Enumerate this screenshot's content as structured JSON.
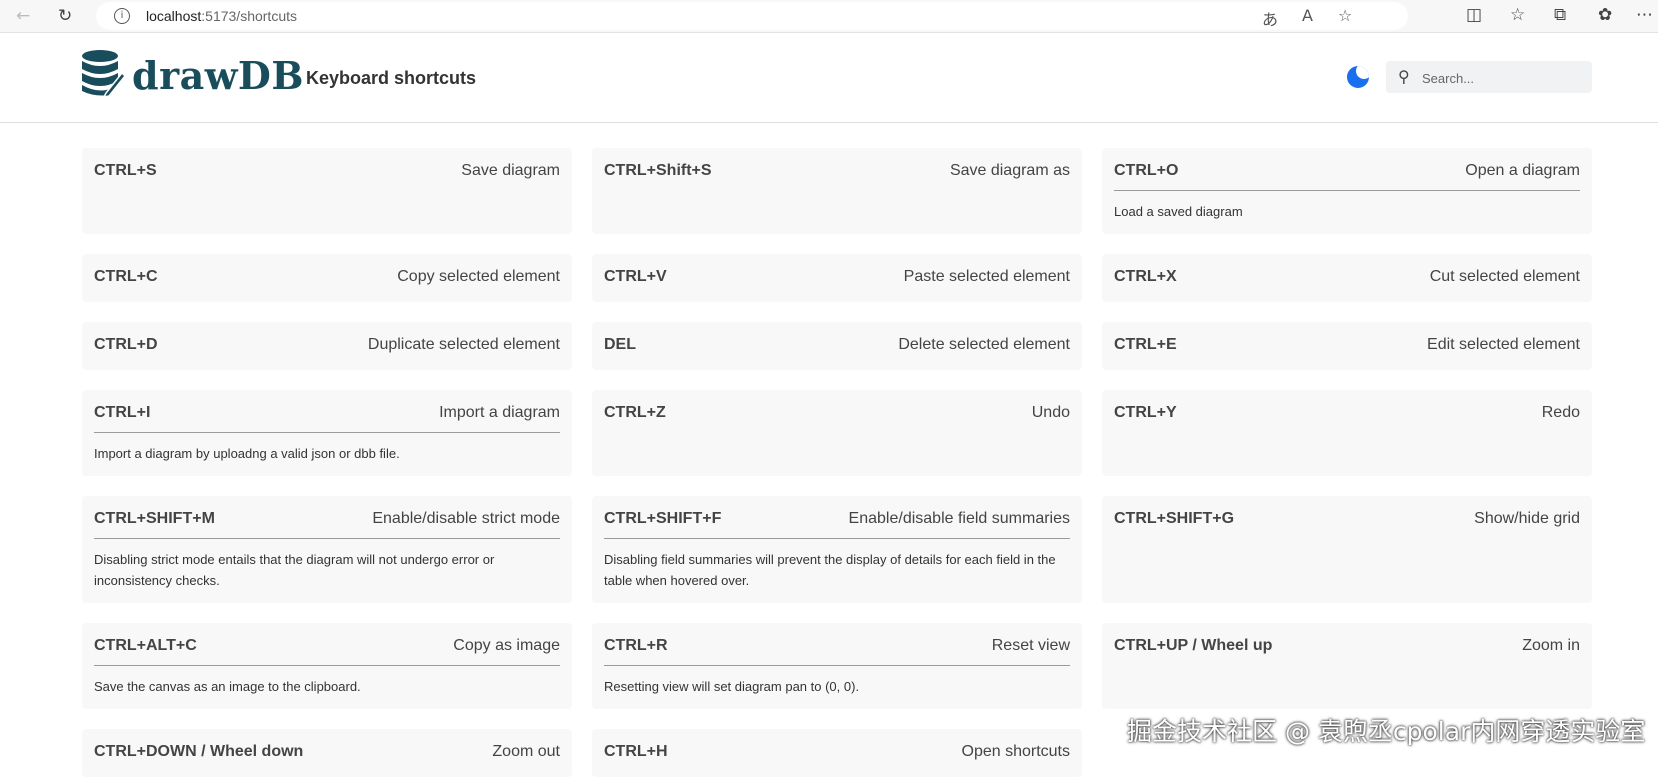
{
  "browser": {
    "url_host": "localhost",
    "url_path": ":5173/shortcuts",
    "icons": [
      "back-icon",
      "refresh-icon",
      "info-icon",
      "read-aloud-icon",
      "text-size-icon",
      "favorite-star-icon",
      "split-screen-icon",
      "favorites-icon",
      "collections-icon",
      "extensions-icon",
      "more-icon"
    ]
  },
  "header": {
    "brand": "drawDB",
    "page_title": "Keyboard shortcuts",
    "search_placeholder": "Search...",
    "theme_icon": "moon-icon",
    "accent_color": "#1870f0",
    "brand_color": "#1a4d5c"
  },
  "shortcuts": [
    {
      "keys": "CTRL+S",
      "title": "Save diagram",
      "desc": ""
    },
    {
      "keys": "CTRL+Shift+S",
      "title": "Save diagram as",
      "desc": ""
    },
    {
      "keys": "CTRL+O",
      "title": "Open a diagram",
      "desc": "Load a saved diagram"
    },
    {
      "keys": "CTRL+C",
      "title": "Copy selected element",
      "desc": ""
    },
    {
      "keys": "CTRL+V",
      "title": "Paste selected element",
      "desc": ""
    },
    {
      "keys": "CTRL+X",
      "title": "Cut selected element",
      "desc": ""
    },
    {
      "keys": "CTRL+D",
      "title": "Duplicate selected element",
      "desc": ""
    },
    {
      "keys": "DEL",
      "title": "Delete selected element",
      "desc": ""
    },
    {
      "keys": "CTRL+E",
      "title": "Edit selected element",
      "desc": ""
    },
    {
      "keys": "CTRL+I",
      "title": "Import a diagram",
      "desc": "Import a diagram by uploadng a valid json or dbb file."
    },
    {
      "keys": "CTRL+Z",
      "title": "Undo",
      "desc": ""
    },
    {
      "keys": "CTRL+Y",
      "title": "Redo",
      "desc": ""
    },
    {
      "keys": "CTRL+SHIFT+M",
      "title": "Enable/disable strict mode",
      "desc": "Disabling strict mode entails that the diagram will not undergo error or inconsistency checks."
    },
    {
      "keys": "CTRL+SHIFT+F",
      "title": "Enable/disable field summaries",
      "desc": "Disabling field summaries will prevent the display of details for each field in the table when hovered over."
    },
    {
      "keys": "CTRL+SHIFT+G",
      "title": "Show/hide grid",
      "desc": ""
    },
    {
      "keys": "CTRL+ALT+C",
      "title": "Copy as image",
      "desc": "Save the canvas as an image to the clipboard."
    },
    {
      "keys": "CTRL+R",
      "title": "Reset view",
      "desc": "Resetting view will set diagram pan to (0, 0)."
    },
    {
      "keys": "CTRL+UP / Wheel up",
      "title": "Zoom in",
      "desc": ""
    },
    {
      "keys": "CTRL+DOWN / Wheel down",
      "title": "Zoom out",
      "desc": ""
    },
    {
      "keys": "CTRL+H",
      "title": "Open shortcuts",
      "desc": ""
    }
  ],
  "watermark": "掘金技术社区 @ 袁煦丞cpolar内网穿透实验室"
}
